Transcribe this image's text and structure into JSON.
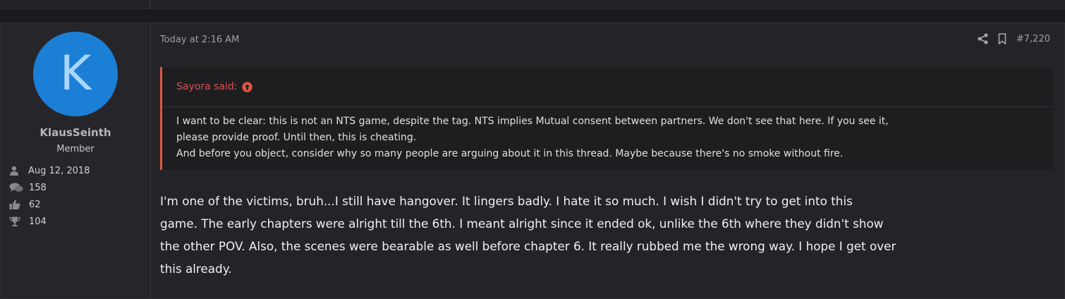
{
  "post": {
    "author": {
      "avatar_letter": "K",
      "avatar_color": "#1b7fd6",
      "username": "KlausSeinth",
      "title": "Member",
      "stats": {
        "joined": "Aug 12, 2018",
        "messages": "158",
        "reactions": "62",
        "points": "104"
      }
    },
    "date": "Today at 2:16 AM",
    "number": "#7,220",
    "quote": {
      "author_label": "Sayora said:",
      "line1": "I want to be clear: this is not an NTS game, despite the tag. NTS implies Mutual consent between partners. We don't see that here. If you see it,",
      "line2": "please provide proof. Until then, this is cheating.",
      "line3": "And before you object, consider why so many people are arguing about it in this thread. Maybe because there's no smoke without fire."
    },
    "message": {
      "line1": "I'm one of the victims, bruh...I still have hangover. It lingers badly. I hate it so much. I wish I didn't try to get into this",
      "line2": "game. The early chapters were alright till the 6th. I meant alright since it ended ok, unlike the 6th where they didn't show",
      "line3": "the other POV. Also, the scenes were bearable as well before chapter 6. It really rubbed me the wrong way. I hope I get over",
      "line4": "this already."
    }
  },
  "icons": {
    "joined": "user-icon",
    "messages": "comments-icon",
    "reactions": "thumbs-up-icon",
    "points": "trophy-icon",
    "share": "share-icon",
    "bookmark": "bookmark-icon",
    "quote_jump": "arrow-up-circle-icon"
  },
  "colors": {
    "quote_accent": "#e0553f",
    "quote_author": "#d9534f"
  }
}
